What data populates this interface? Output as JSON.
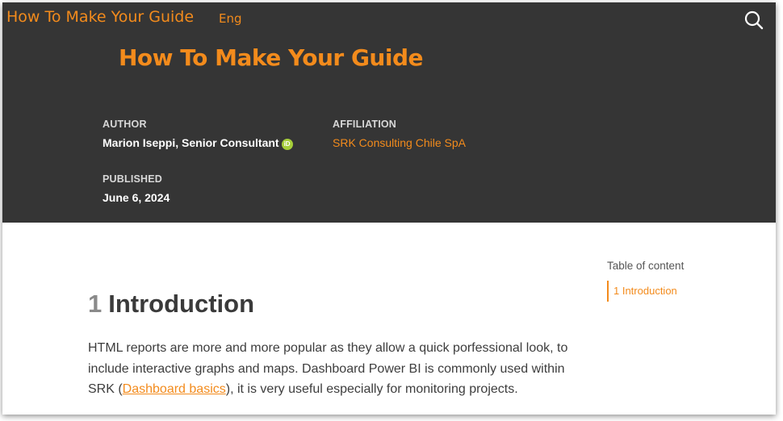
{
  "header": {
    "site_title": "How To Make Your Guide",
    "language": "Eng",
    "search_icon": "search-icon"
  },
  "title_block": {
    "title": "How To Make Your Guide",
    "author_label": "AUTHOR",
    "author_name": "Marion Iseppi, Senior Consultant",
    "orcid_icon": "orcid-icon",
    "orcid_text": "iD",
    "affiliation_label": "AFFILIATION",
    "affiliation": "SRK Consulting Chile SpA",
    "published_label": "PUBLISHED",
    "published_date": "June 6, 2024"
  },
  "content": {
    "section_number": "1",
    "section_title": "Introduction",
    "paragraph_part1": "HTML reports are more and more popular as they allow a quick porfessional look, to include interactive graphs and maps. Dashboard Power BI is commonly used within SRK (",
    "link_text": "Dashboard basics",
    "paragraph_part2": "), it is very useful especially for monitoring projects."
  },
  "toc": {
    "title": "Table of content",
    "items": [
      {
        "label": "1 Introduction"
      }
    ]
  },
  "colors": {
    "accent": "#f38b1c",
    "banner_bg": "#353535",
    "orcid": "#a6ce39"
  }
}
